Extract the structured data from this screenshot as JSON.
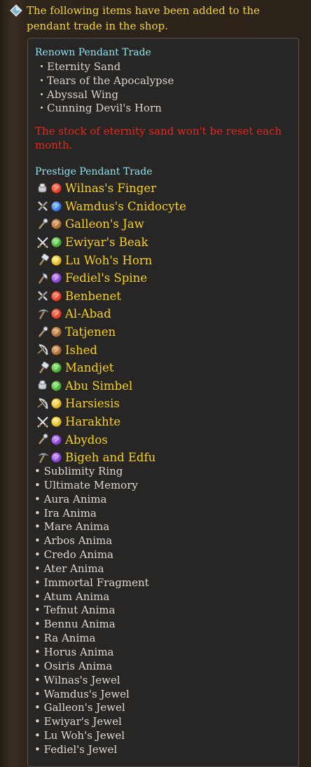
{
  "header": {
    "icon": "diamond-bullet-icon",
    "text": "The following items have been added to the pendant trade in the shop."
  },
  "renown": {
    "title": "Renown Pendant Trade",
    "items": [
      "・Eternity Sand",
      "・Tears of the Apocalypse",
      "・Abyssal Wing",
      "・Cunning Devil's Horn"
    ]
  },
  "notice": "The stock of eternity sand won't be reset each month.",
  "prestige": {
    "title": "Prestige Pendant Trade",
    "items": [
      {
        "name": "Wilnas's Finger",
        "weapon": "gauntlet-icon",
        "element": "fire-icon"
      },
      {
        "name": "Wamdus's Cnidocyte",
        "weapon": "crossed-weapons-icon",
        "element": "water-icon"
      },
      {
        "name": "Galleon's Jaw",
        "weapon": "staff-icon",
        "element": "earth-icon"
      },
      {
        "name": "Ewiyar's Beak",
        "weapon": "crossed-swords-icon",
        "element": "wind-icon"
      },
      {
        "name": "Lu Woh's Horn",
        "weapon": "hammer-icon",
        "element": "light-icon"
      },
      {
        "name": "Fediel's Spine",
        "weapon": "axe-icon",
        "element": "dark-icon"
      },
      {
        "name": "Benbenet",
        "weapon": "crossed-weapons-icon",
        "element": "fire-icon"
      },
      {
        "name": "Al-Abad",
        "weapon": "pickaxe-icon",
        "element": "fire-icon"
      },
      {
        "name": "Tatjenen",
        "weapon": "staff-icon",
        "element": "earth-icon"
      },
      {
        "name": "Ished",
        "weapon": "bow-icon",
        "element": "earth-icon"
      },
      {
        "name": "Mandjet",
        "weapon": "hammer-icon",
        "element": "wind-icon"
      },
      {
        "name": "Abu Simbel",
        "weapon": "gauntlet-icon",
        "element": "wind-icon"
      },
      {
        "name": "Harsiesis",
        "weapon": "bow-icon",
        "element": "light-icon"
      },
      {
        "name": "Harakhte",
        "weapon": "crossed-swords-icon",
        "element": "light-icon"
      },
      {
        "name": "Abydos",
        "weapon": "staff-icon",
        "element": "dark-icon"
      },
      {
        "name": "Bigeh and Edfu",
        "weapon": "pickaxe-icon",
        "element": "dark-icon"
      }
    ]
  },
  "materials": [
    "• Sublimity Ring",
    "• Ultimate Memory",
    "• Aura Anima",
    "• Ira Anima",
    "• Mare Anima",
    "• Arbos Anima",
    "• Credo Anima",
    "• Ater Anima",
    "• Immortal Fragment",
    "• Atum Anima",
    "• Tefnut Anima",
    "• Bennu Anima",
    "• Ra Anima",
    "• Horus Anima",
    "• Osiris Anima",
    "• Wilnas's Jewel",
    "• Wamdus's Jewel",
    "• Galleon's Jewel",
    "• Ewiyar's Jewel",
    "• Lu Woh's Jewel",
    "• Fediel's Jewel"
  ],
  "colors": {
    "background": "#2b2219",
    "panel": "#282624",
    "header_text": "#f5d33a",
    "section_title": "#8fe3f0",
    "notice": "#e5281f",
    "item_name": "#f6d11e",
    "list_text": "#dedad2"
  }
}
